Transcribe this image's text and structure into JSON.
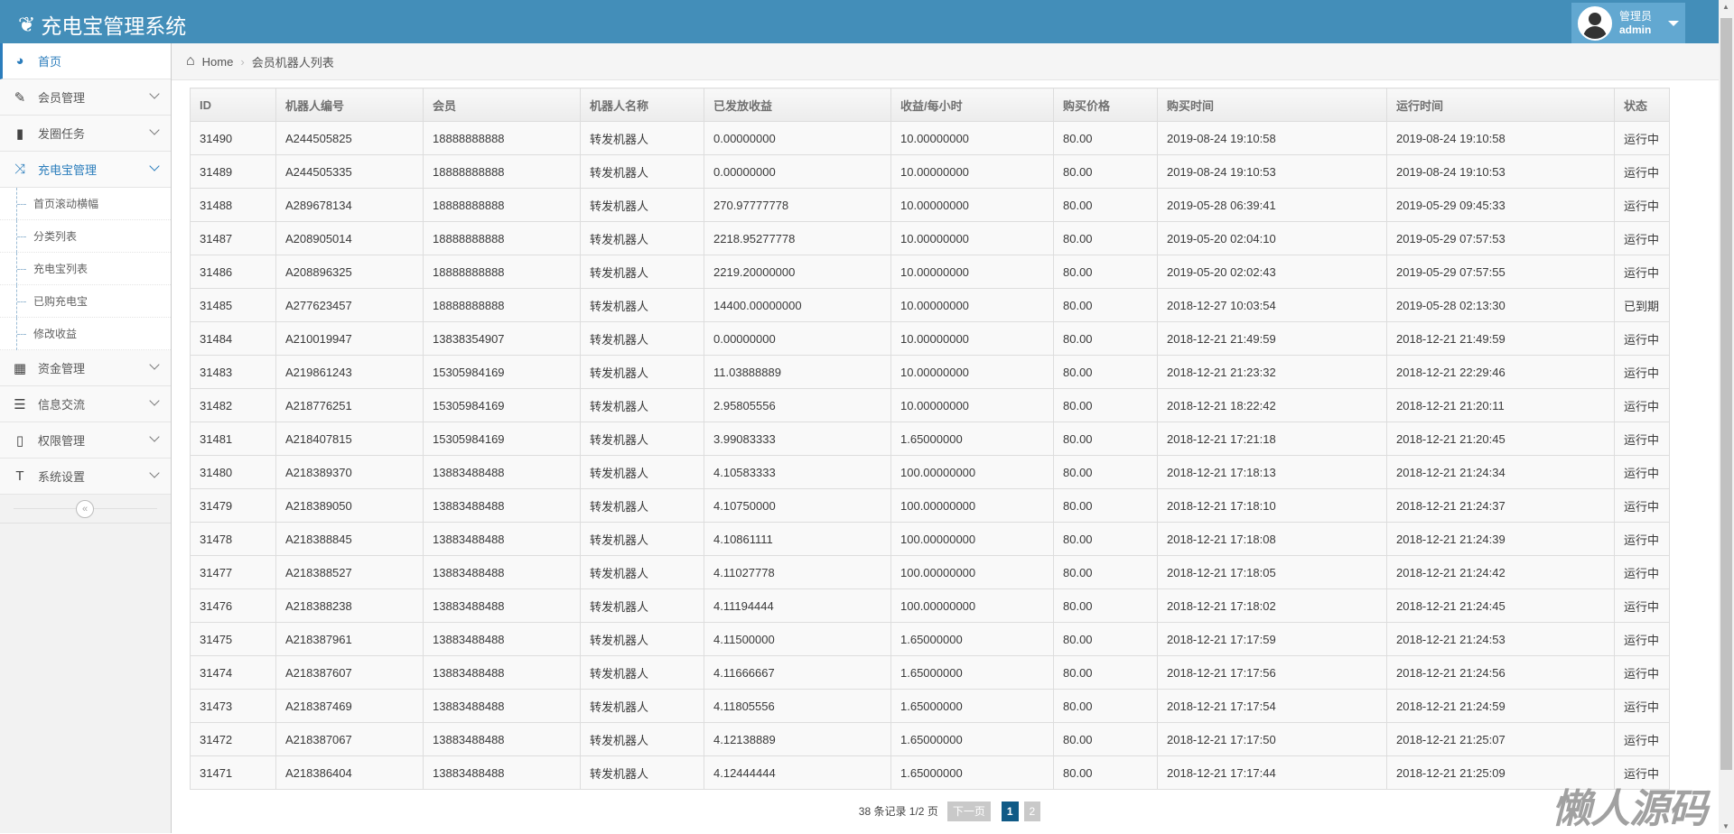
{
  "app": {
    "title": "充电宝管理系统"
  },
  "user": {
    "role": "管理员",
    "name": "admin"
  },
  "sidebar": {
    "items": [
      {
        "label": "首页",
        "icon": "dashboard-icon"
      },
      {
        "label": "会员管理",
        "icon": "edit-icon"
      },
      {
        "label": "发圈任务",
        "icon": "book-icon"
      },
      {
        "label": "充电宝管理",
        "icon": "random-icon"
      },
      {
        "label": "资金管理",
        "icon": "calendar-icon"
      },
      {
        "label": "信息交流",
        "icon": "list-icon"
      },
      {
        "label": "权限管理",
        "icon": "file-icon"
      },
      {
        "label": "系统设置",
        "icon": "text-icon"
      }
    ],
    "submenu": [
      "首页滚动横幅",
      "分类列表",
      "充电宝列表",
      "已购充电宝",
      "修改收益"
    ]
  },
  "breadcrumb": {
    "home": "Home",
    "current": "会员机器人列表"
  },
  "table": {
    "headers": [
      "ID",
      "机器人编号",
      "会员",
      "机器人名称",
      "已发放收益",
      "收益/每小时",
      "购买价格",
      "购买时间",
      "运行时间",
      "状态"
    ],
    "rows": [
      [
        "31490",
        "A244505825",
        "18888888888",
        "转发机器人",
        "0.00000000",
        "10.00000000",
        "80.00",
        "2019-08-24 19:10:58",
        "2019-08-24 19:10:58",
        "运行中"
      ],
      [
        "31489",
        "A244505335",
        "18888888888",
        "转发机器人",
        "0.00000000",
        "10.00000000",
        "80.00",
        "2019-08-24 19:10:53",
        "2019-08-24 19:10:53",
        "运行中"
      ],
      [
        "31488",
        "A289678134",
        "18888888888",
        "转发机器人",
        "270.97777778",
        "10.00000000",
        "80.00",
        "2019-05-28 06:39:41",
        "2019-05-29 09:45:33",
        "运行中"
      ],
      [
        "31487",
        "A208905014",
        "18888888888",
        "转发机器人",
        "2218.95277778",
        "10.00000000",
        "80.00",
        "2019-05-20 02:04:10",
        "2019-05-29 07:57:53",
        "运行中"
      ],
      [
        "31486",
        "A208896325",
        "18888888888",
        "转发机器人",
        "2219.20000000",
        "10.00000000",
        "80.00",
        "2019-05-20 02:02:43",
        "2019-05-29 07:57:55",
        "运行中"
      ],
      [
        "31485",
        "A277623457",
        "18888888888",
        "转发机器人",
        "14400.00000000",
        "10.00000000",
        "80.00",
        "2018-12-27 10:03:54",
        "2019-05-28 02:13:30",
        "已到期"
      ],
      [
        "31484",
        "A210019947",
        "13838354907",
        "转发机器人",
        "0.00000000",
        "10.00000000",
        "80.00",
        "2018-12-21 21:49:59",
        "2018-12-21 21:49:59",
        "运行中"
      ],
      [
        "31483",
        "A219861243",
        "15305984169",
        "转发机器人",
        "11.03888889",
        "10.00000000",
        "80.00",
        "2018-12-21 21:23:32",
        "2018-12-21 22:29:46",
        "运行中"
      ],
      [
        "31482",
        "A218776251",
        "15305984169",
        "转发机器人",
        "2.95805556",
        "10.00000000",
        "80.00",
        "2018-12-21 18:22:42",
        "2018-12-21 21:20:11",
        "运行中"
      ],
      [
        "31481",
        "A218407815",
        "15305984169",
        "转发机器人",
        "3.99083333",
        "1.65000000",
        "80.00",
        "2018-12-21 17:21:18",
        "2018-12-21 21:20:45",
        "运行中"
      ],
      [
        "31480",
        "A218389370",
        "13883488488",
        "转发机器人",
        "4.10583333",
        "100.00000000",
        "80.00",
        "2018-12-21 17:18:13",
        "2018-12-21 21:24:34",
        "运行中"
      ],
      [
        "31479",
        "A218389050",
        "13883488488",
        "转发机器人",
        "4.10750000",
        "100.00000000",
        "80.00",
        "2018-12-21 17:18:10",
        "2018-12-21 21:24:37",
        "运行中"
      ],
      [
        "31478",
        "A218388845",
        "13883488488",
        "转发机器人",
        "4.10861111",
        "100.00000000",
        "80.00",
        "2018-12-21 17:18:08",
        "2018-12-21 21:24:39",
        "运行中"
      ],
      [
        "31477",
        "A218388527",
        "13883488488",
        "转发机器人",
        "4.11027778",
        "100.00000000",
        "80.00",
        "2018-12-21 17:18:05",
        "2018-12-21 21:24:42",
        "运行中"
      ],
      [
        "31476",
        "A218388238",
        "13883488488",
        "转发机器人",
        "4.11194444",
        "100.00000000",
        "80.00",
        "2018-12-21 17:18:02",
        "2018-12-21 21:24:45",
        "运行中"
      ],
      [
        "31475",
        "A218387961",
        "13883488488",
        "转发机器人",
        "4.11500000",
        "1.65000000",
        "80.00",
        "2018-12-21 17:17:59",
        "2018-12-21 21:24:53",
        "运行中"
      ],
      [
        "31474",
        "A218387607",
        "13883488488",
        "转发机器人",
        "4.11666667",
        "1.65000000",
        "80.00",
        "2018-12-21 17:17:56",
        "2018-12-21 21:24:56",
        "运行中"
      ],
      [
        "31473",
        "A218387469",
        "13883488488",
        "转发机器人",
        "4.11805556",
        "1.65000000",
        "80.00",
        "2018-12-21 17:17:54",
        "2018-12-21 21:24:59",
        "运行中"
      ],
      [
        "31472",
        "A218387067",
        "13883488488",
        "转发机器人",
        "4.12138889",
        "1.65000000",
        "80.00",
        "2018-12-21 17:17:50",
        "2018-12-21 21:25:07",
        "运行中"
      ],
      [
        "31471",
        "A218386404",
        "13883488488",
        "转发机器人",
        "4.12444444",
        "1.65000000",
        "80.00",
        "2018-12-21 17:17:44",
        "2018-12-21 21:25:09",
        "运行中"
      ]
    ]
  },
  "pagination": {
    "summary": "38 条记录 1/2 页",
    "next": "下一页",
    "pages": [
      "1",
      "2"
    ],
    "current": "1"
  },
  "watermark": "懒人源码",
  "colors": {
    "header": "#438eb9",
    "accent": "#2b7dbc",
    "page_active": "#105a86"
  }
}
